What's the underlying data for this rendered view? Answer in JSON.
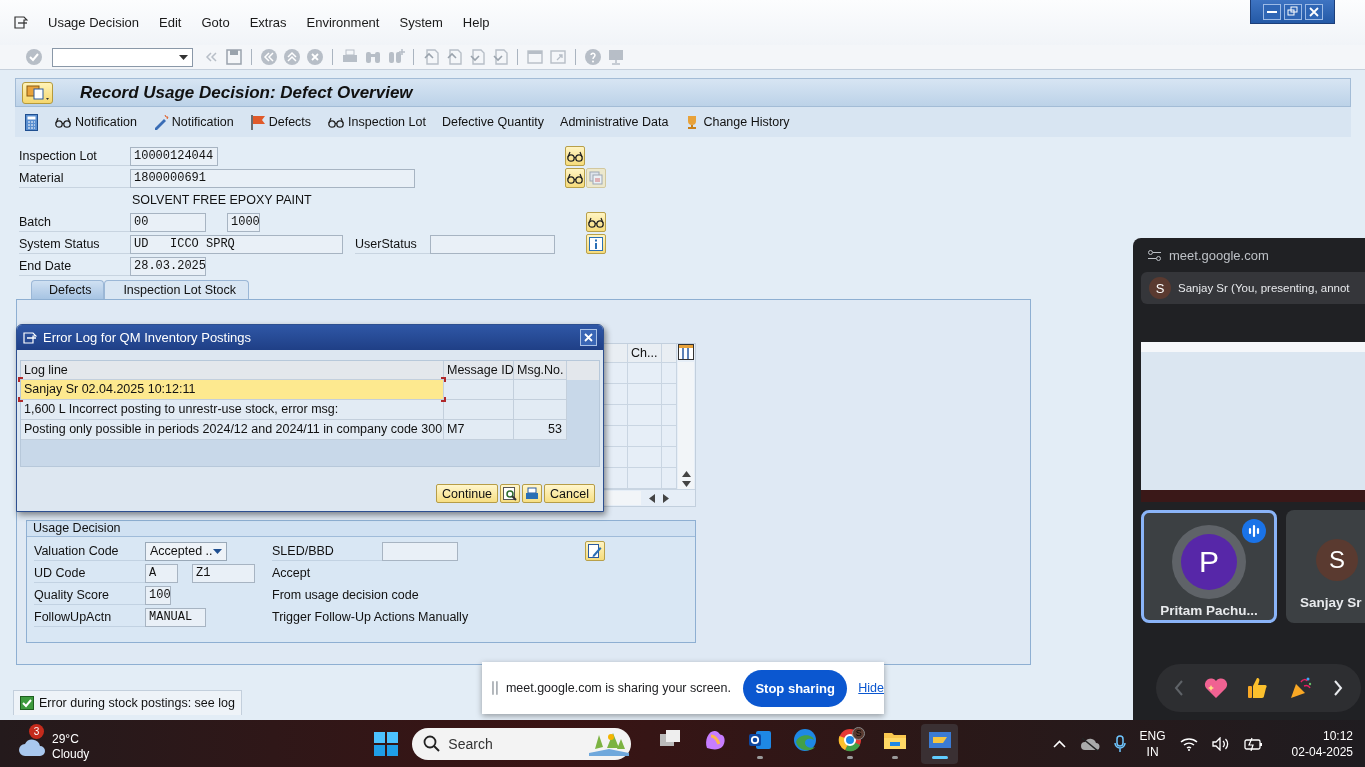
{
  "menu_bar": [
    {
      "label": "Usage Decision"
    },
    {
      "label": "Edit"
    },
    {
      "label": "Goto"
    },
    {
      "label": "Extras"
    },
    {
      "label": "Environment"
    },
    {
      "label": "System"
    },
    {
      "label": "Help"
    }
  ],
  "screen_title": "Record Usage Decision: Defect Overview",
  "app_toolbar": [
    {
      "label": "Notification",
      "kind": "display"
    },
    {
      "label": "Notification",
      "kind": "create"
    },
    {
      "label": "Defects",
      "kind": "flag"
    },
    {
      "label": "Inspection Lot",
      "kind": "display"
    },
    {
      "label": "Defective Quantity",
      "kind": "plain"
    },
    {
      "label": "Administrative Data",
      "kind": "plain"
    },
    {
      "label": "Change History",
      "kind": "history"
    }
  ],
  "header": {
    "inspection_lot": {
      "label": "Inspection Lot",
      "value": "10000124044"
    },
    "material": {
      "label": "Material",
      "value": "1800000691",
      "description": "SOLVENT FREE EPOXY PAINT"
    },
    "batch": {
      "label": "Batch",
      "value": "00",
      "plant": "1000"
    },
    "system_status": {
      "label": "System Status",
      "value": "UD   ICCO SPRQ"
    },
    "user_status": {
      "label": "UserStatus"
    },
    "end_date": {
      "label": "End Date",
      "value": "28.03.2025"
    }
  },
  "tabs": [
    {
      "label": "Defects",
      "selected": true
    },
    {
      "label": "Inspection Lot Stock",
      "selected": false
    }
  ],
  "defects_table": {
    "columns": [
      {
        "label": "Ch..."
      }
    ]
  },
  "usage_decision": {
    "title": "Usage Decision",
    "valuation_code": {
      "label": "Valuation Code",
      "value": "Accepted .."
    },
    "sled": {
      "label": "SLED/BBD"
    },
    "ud_code": {
      "label": "UD Code",
      "value": "A",
      "code": "Z1",
      "text": "Accept"
    },
    "quality_score": {
      "label": "Quality Score",
      "value": "100",
      "text": "From usage decision code"
    },
    "follow_up": {
      "label": "FollowUpActn",
      "value": "MANUAL",
      "text": "Trigger Follow-Up Actions Manually"
    }
  },
  "status_bar": {
    "message": "Error during stock postings: see log"
  },
  "dialog": {
    "title": "Error Log for QM Inventory Postings",
    "columns": [
      "Log line",
      "Message ID",
      "Msg.No."
    ],
    "rows": [
      {
        "log_line": "Sanjay Sr 02.04.2025 10:12:11",
        "selected": true
      },
      {
        "log_line": "1,600 L Incorrect posting to unrestr-use stock, error msg:",
        "selected": false
      },
      {
        "log_line": "Posting only possible in periods 2024/12 and 2024/11 in company code 300",
        "message_id": "M7",
        "msg_no": "53",
        "selected": false
      }
    ],
    "continue_button": "Continue",
    "cancel_button": "Cancel"
  },
  "meet_panel": {
    "site": "meet.google.com",
    "presenter": {
      "initial": "S",
      "text": "Sanjay Sr (You, presenting, annot"
    },
    "tiles": [
      {
        "initial": "P",
        "name": "Pritam Pachu...",
        "color": "#5727a8",
        "speaking": true
      },
      {
        "initial": "S",
        "name": "Sanjay Sr",
        "color": "#5a3a30",
        "speaking": false
      }
    ]
  },
  "share_bar": {
    "message": "meet.google.com is sharing your screen.",
    "stop_button": "Stop sharing",
    "hide_link": "Hide"
  },
  "taskbar": {
    "weather": {
      "badge": "3",
      "temperature": "29°C",
      "condition": "Cloudy"
    },
    "search": {
      "placeholder": "Search"
    },
    "apps": [
      {
        "kind": "task_view",
        "running": false,
        "selected": false
      },
      {
        "kind": "copilot",
        "running": false,
        "selected": false
      },
      {
        "kind": "outlook",
        "running": true,
        "selected": false
      },
      {
        "kind": "edge",
        "running": false,
        "selected": false
      },
      {
        "kind": "chrome",
        "running": true,
        "selected": false,
        "badge": "S"
      },
      {
        "kind": "files",
        "running": true,
        "selected": false
      },
      {
        "kind": "sap",
        "running": true,
        "selected": true
      }
    ],
    "language": "ENG",
    "region": "IN",
    "time": "10:12",
    "date": "02-04-2025"
  }
}
